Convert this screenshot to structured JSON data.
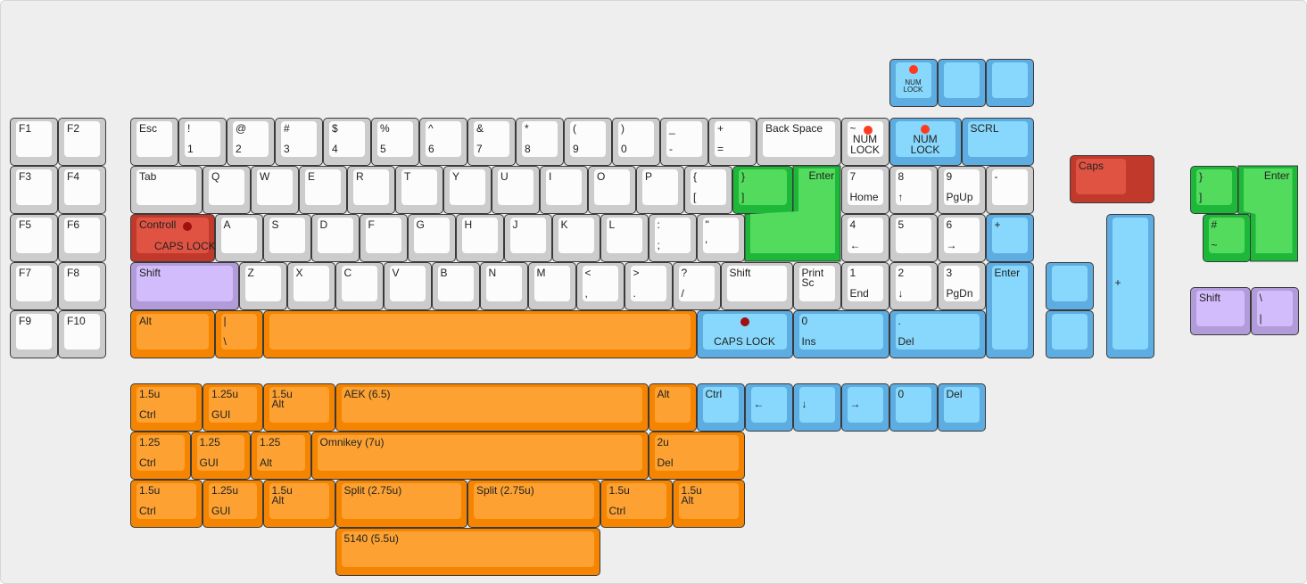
{
  "colors": {
    "grey": {
      "outer": "#cccccc",
      "inner": "#fcfcfc"
    },
    "blue": {
      "outer": "#5dade2",
      "inner": "#87d8fc"
    },
    "orange": {
      "outer": "#f58500",
      "inner": "#fda232"
    },
    "green": {
      "outer": "#1db83a",
      "inner": "#53db5e"
    },
    "red": {
      "outer": "#c0392b",
      "inner": "#e05343"
    },
    "purple": {
      "outer": "#b19cd9",
      "inner": "#d3bcfc"
    },
    "led_bright": "#ff3b1f",
    "led_dark": "#a01010"
  },
  "keys": [
    {
      "ctr": "NUM\nLOCK",
      "small": true,
      "led": "led_bright",
      "c": "blue"
    },
    {
      "c": "blue"
    },
    {
      "c": "blue"
    },
    {
      "tl": "F1",
      "c": "grey"
    },
    {
      "tl": "F2",
      "c": "grey"
    },
    {
      "tl": "Esc",
      "c": "grey"
    },
    {
      "tl": "!",
      "bl": "1",
      "c": "grey"
    },
    {
      "tl": "@",
      "bl": "2",
      "c": "grey"
    },
    {
      "tl": "#",
      "bl": "3",
      "c": "grey"
    },
    {
      "tl": "$",
      "bl": "4",
      "c": "grey"
    },
    {
      "tl": "%",
      "bl": "5",
      "c": "grey"
    },
    {
      "tl": "^",
      "bl": "6",
      "c": "grey"
    },
    {
      "tl": "&",
      "bl": "7",
      "c": "grey"
    },
    {
      "tl": "*",
      "bl": "8",
      "c": "grey"
    },
    {
      "tl": "(",
      "bl": "9",
      "c": "grey"
    },
    {
      "tl": ")",
      "bl": "0",
      "c": "grey"
    },
    {
      "tl": "_",
      "bl": "-",
      "c": "grey"
    },
    {
      "tl": "+",
      "bl": "=",
      "c": "grey"
    },
    {
      "tl": "Back Space",
      "c": "grey"
    },
    {
      "tl": "~",
      "ctr": "NUM\nLOCK",
      "led": "led_bright",
      "c": "grey"
    },
    {
      "ctr": "NUM\nLOCK",
      "led": "led_bright",
      "c": "blue"
    },
    {
      "tl": "SCRL",
      "c": "blue"
    },
    {
      "tl": "F3",
      "c": "grey"
    },
    {
      "tl": "F4",
      "c": "grey"
    },
    {
      "tl": "Tab",
      "c": "grey"
    },
    {
      "tl": "Q",
      "c": "grey"
    },
    {
      "tl": "W",
      "c": "grey"
    },
    {
      "tl": "E",
      "c": "grey"
    },
    {
      "tl": "R",
      "c": "grey"
    },
    {
      "tl": "T",
      "c": "grey"
    },
    {
      "tl": "Y",
      "c": "grey"
    },
    {
      "tl": "U",
      "c": "grey"
    },
    {
      "tl": "I",
      "c": "grey"
    },
    {
      "tl": "O",
      "c": "grey"
    },
    {
      "tl": "P",
      "c": "grey"
    },
    {
      "tl": "{",
      "bl": "[",
      "c": "grey"
    },
    {
      "tl": "}",
      "bl": "]",
      "c": "green"
    },
    {
      "tl": "Enter",
      "c": "green",
      "shape": "iso"
    },
    {
      "tl": "7",
      "bl": "Home",
      "c": "grey"
    },
    {
      "tl": "8",
      "bl": "↑",
      "c": "grey"
    },
    {
      "tl": "9",
      "bl": "PgUp",
      "c": "grey"
    },
    {
      "tl": "-",
      "c": "grey"
    },
    {
      "tl": "F5",
      "c": "grey"
    },
    {
      "tl": "F6",
      "c": "grey"
    },
    {
      "tl": "Controll",
      "ctr": "CAPS LOCK",
      "led": "led_dark",
      "c": "red"
    },
    {
      "tl": "A",
      "c": "grey"
    },
    {
      "tl": "S",
      "c": "grey"
    },
    {
      "tl": "D",
      "c": "grey"
    },
    {
      "tl": "F",
      "c": "grey"
    },
    {
      "tl": "G",
      "c": "grey"
    },
    {
      "tl": "H",
      "c": "grey"
    },
    {
      "tl": "J",
      "c": "grey"
    },
    {
      "tl": "K",
      "c": "grey"
    },
    {
      "tl": "L",
      "c": "grey"
    },
    {
      "tl": ":",
      "bl": ";",
      "c": "grey"
    },
    {
      "tl": "\"",
      "bl": "'",
      "c": "grey"
    },
    {
      "tl": "4",
      "bl": "←",
      "c": "grey"
    },
    {
      "tl": "5",
      "c": "grey"
    },
    {
      "tl": "6",
      "bl": "→",
      "c": "grey"
    },
    {
      "tl": "+",
      "c": "blue"
    },
    {
      "tl": "F7",
      "c": "grey"
    },
    {
      "tl": "F8",
      "c": "grey"
    },
    {
      "tl": "Shift",
      "c": "purple"
    },
    {
      "tl": "Z",
      "c": "grey"
    },
    {
      "tl": "X",
      "c": "grey"
    },
    {
      "tl": "C",
      "c": "grey"
    },
    {
      "tl": "V",
      "c": "grey"
    },
    {
      "tl": "B",
      "c": "grey"
    },
    {
      "tl": "N",
      "c": "grey"
    },
    {
      "tl": "M",
      "c": "grey"
    },
    {
      "tl": "<",
      "bl": ",",
      "c": "grey"
    },
    {
      "tl": ">",
      "bl": ".",
      "c": "grey"
    },
    {
      "tl": "?",
      "bl": "/",
      "c": "grey"
    },
    {
      "tl": "Shift",
      "c": "grey"
    },
    {
      "tl": "Print\nSc",
      "c": "grey"
    },
    {
      "tl": "1",
      "bl": "End",
      "c": "grey"
    },
    {
      "tl": "2",
      "bl": "↓",
      "c": "grey"
    },
    {
      "tl": "3",
      "bl": "PgDn",
      "c": "grey"
    },
    {
      "tl": "Enter",
      "c": "blue"
    },
    {
      "tl": "F9",
      "c": "grey"
    },
    {
      "tl": "F10",
      "c": "grey"
    },
    {
      "tl": "Alt",
      "c": "orange"
    },
    {
      "tl": "|",
      "bl": "\\",
      "c": "orange"
    },
    {
      "c": "orange"
    },
    {
      "ctr": "CAPS LOCK",
      "led": "led_dark",
      "c": "blue",
      "ledtop": true
    },
    {
      "tl": "0",
      "bl": "Ins",
      "c": "blue"
    },
    {
      "tl": ".",
      "bl": "Del",
      "c": "blue"
    },
    {
      "tl": "Caps",
      "c": "red",
      "shape": "stepped"
    },
    {
      "c": "blue"
    },
    {
      "c": "blue"
    },
    {
      "ml": "+",
      "c": "blue"
    },
    {
      "tl": "}",
      "bl": "]",
      "c": "green"
    },
    {
      "tl": "Enter",
      "c": "green",
      "shape": "iso2"
    },
    {
      "tl": "#",
      "bl": "~",
      "c": "green"
    },
    {
      "tl": "Shift",
      "c": "purple"
    },
    {
      "tl": "\\",
      "bl": "|",
      "c": "purple"
    },
    {
      "tl": "1.5u",
      "bl": "Ctrl",
      "c": "orange"
    },
    {
      "tl": "1.25u",
      "bl": "GUI",
      "c": "orange"
    },
    {
      "tl": "1.5u\nAlt",
      "c": "orange"
    },
    {
      "tl": "AEK (6.5)",
      "c": "orange"
    },
    {
      "tl": "Alt",
      "c": "orange"
    },
    {
      "tl": "Ctrl",
      "c": "blue"
    },
    {
      "ml": "←",
      "c": "blue"
    },
    {
      "ml": "↓",
      "c": "blue"
    },
    {
      "ml": "→",
      "c": "blue"
    },
    {
      "tl": "0",
      "c": "blue"
    },
    {
      "tl": "Del",
      "c": "blue"
    },
    {
      "tl": "1.25",
      "bl": "Ctrl",
      "c": "orange"
    },
    {
      "tl": "1.25",
      "bl": "GUI",
      "c": "orange"
    },
    {
      "tl": "1.25",
      "bl": "Alt",
      "c": "orange"
    },
    {
      "tl": "Omnikey (7u)",
      "c": "orange"
    },
    {
      "tl": "2u",
      "bl": "Del",
      "c": "orange"
    },
    {
      "tl": "1.5u",
      "bl": "Ctrl",
      "c": "orange"
    },
    {
      "tl": "1.25u",
      "bl": "GUI",
      "c": "orange"
    },
    {
      "tl": "1.5u\nAlt",
      "c": "orange"
    },
    {
      "tl": "Split (2.75u)",
      "c": "orange"
    },
    {
      "tl": "Split (2.75u)",
      "c": "orange"
    },
    {
      "tl": "1.5u",
      "bl": "Ctrl",
      "c": "orange"
    },
    {
      "tl": "1.5u\nAlt",
      "c": "orange"
    },
    {
      "tl": "5140 (5.5u)",
      "c": "orange"
    }
  ]
}
